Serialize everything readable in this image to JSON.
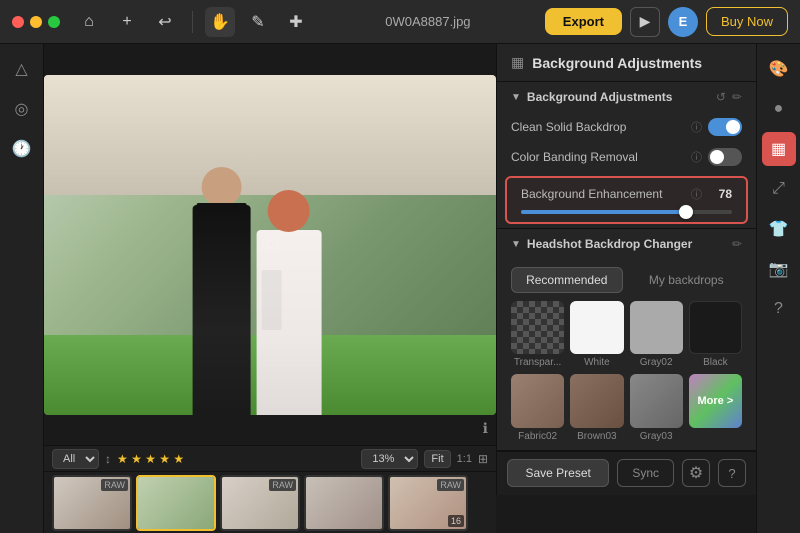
{
  "topbar": {
    "filename": "0W0A8887.jpg",
    "export_label": "Export",
    "buynow_label": "Buy Now",
    "avatar_letter": "E"
  },
  "left_toolbar": {
    "buttons": [
      "△",
      "◎",
      "🕐"
    ]
  },
  "right_panel": {
    "header_title": "Background Adjustments",
    "sections": [
      {
        "id": "bg_adjustments",
        "title": "Background Adjustments",
        "rows": [
          {
            "label": "Clean Solid Backdrop",
            "toggle": "on"
          },
          {
            "label": "Color Banding Removal",
            "toggle": "off"
          }
        ],
        "slider": {
          "label": "Background Enhancement",
          "value": 78,
          "percent": 78
        }
      },
      {
        "id": "headshot",
        "title": "Headshot Backdrop Changer",
        "tabs": [
          {
            "label": "Recommended",
            "active": true
          },
          {
            "label": "My backdrops",
            "active": false
          }
        ],
        "backdrops": [
          {
            "id": "transparent",
            "name": "Transpar...",
            "type": "transparent"
          },
          {
            "id": "white",
            "name": "White",
            "type": "white"
          },
          {
            "id": "gray02",
            "name": "Gray02",
            "type": "gray02"
          },
          {
            "id": "black",
            "name": "Black",
            "type": "black"
          },
          {
            "id": "fabric02",
            "name": "Fabric02",
            "type": "fabric02"
          },
          {
            "id": "brown03",
            "name": "Brown03",
            "type": "brown03"
          },
          {
            "id": "gray03",
            "name": "Gray03",
            "type": "gray03"
          },
          {
            "id": "more",
            "name": "More >",
            "type": "more"
          }
        ]
      }
    ]
  },
  "bottom_bar": {
    "save_preset": "Save Preset",
    "sync": "Sync"
  },
  "filmstrip": {
    "filter_options": [
      "All"
    ],
    "filter_selected": "All",
    "zoom_value": "13%",
    "fit_label": "Fit",
    "ratio_label": "1:1"
  },
  "far_right": {
    "buttons": [
      "palette",
      "circle",
      "grid",
      "resize",
      "camera",
      "help"
    ]
  }
}
